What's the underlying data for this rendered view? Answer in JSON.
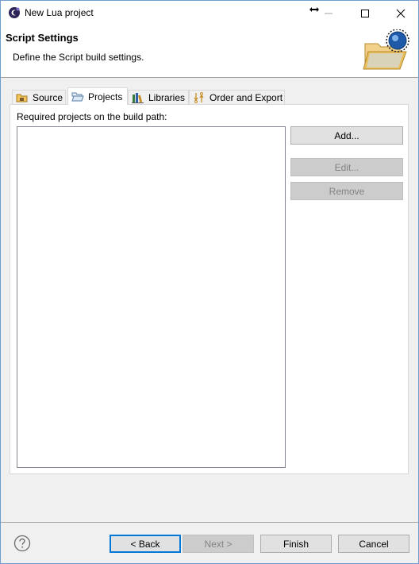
{
  "window": {
    "title": "New Lua project",
    "icon": "eclipse-lua-icon"
  },
  "banner": {
    "title": "Script Settings",
    "description": "Define the Script build settings.",
    "image": "folder-wizard-icon"
  },
  "tabs": [
    {
      "label": "Source",
      "icon": "source-folder-icon",
      "active": false
    },
    {
      "label": "Projects",
      "icon": "open-folder-icon",
      "active": true
    },
    {
      "label": "Libraries",
      "icon": "libraries-icon",
      "active": false
    },
    {
      "label": "Order and Export",
      "icon": "order-export-icon",
      "active": false
    }
  ],
  "projects_panel": {
    "label": "Required projects on the build path:",
    "items": [],
    "buttons": {
      "add": "Add...",
      "edit": "Edit...",
      "remove": "Remove"
    }
  },
  "footer": {
    "back": "< Back",
    "next": "Next >",
    "finish": "Finish",
    "cancel": "Cancel"
  },
  "colors": {
    "accent": "#0078d7",
    "window_border": "#6e9ecf"
  }
}
